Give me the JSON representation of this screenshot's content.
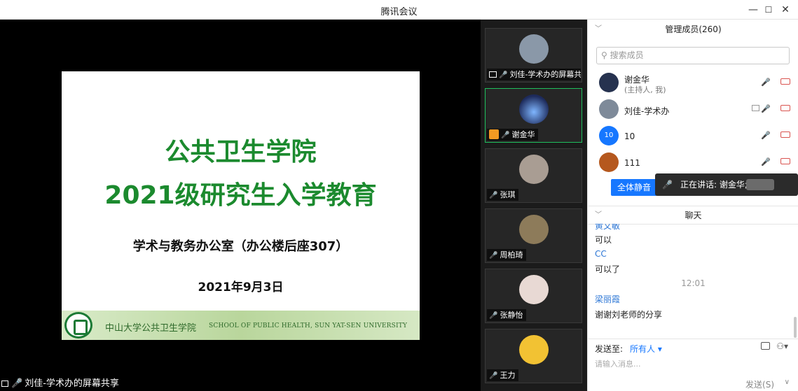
{
  "window": {
    "title": "腾讯会议",
    "minimize": "—",
    "maximize": "☐",
    "close": "✕"
  },
  "slide": {
    "title1": "公共卫生学院",
    "title2": "2021级研究生入学教育",
    "office": "学术与教务办公室（办公楼后座307）",
    "date": "2021年9月3日",
    "footer_cn": "中山大学公共卫生学院",
    "footer_en": "SCHOOL OF PUBLIC HEALTH, SUN YAT-SEN UNIVERSITY"
  },
  "share_label": "刘佳-学术办的屏幕共享",
  "video_tiles": [
    {
      "name": "刘佳-学术办的屏幕共...",
      "icon": "share-screen-icon",
      "mic": "muted"
    },
    {
      "name": "谢金华",
      "icon": "host-icon",
      "mic": "on"
    },
    {
      "name": "张琪",
      "mic": "muted"
    },
    {
      "name": "周柏琦",
      "mic": "muted"
    },
    {
      "name": "张静怡",
      "mic": "muted"
    },
    {
      "name": "王力",
      "mic": "muted"
    }
  ],
  "members_panel": {
    "header": "管理成员(260)",
    "search_placeholder": "搜索成员",
    "members": [
      {
        "name": "谢金华",
        "sub": "(主持人, 我)"
      },
      {
        "name": "刘佳-学术办"
      },
      {
        "name": "10",
        "avatar_text": "10"
      },
      {
        "name": "111"
      }
    ],
    "mute_all": "全体静音"
  },
  "speaking_indicator": "正在讲话: 谢金华;",
  "chat_panel": {
    "header": "聊天",
    "messages": [
      {
        "sender": "黄文敏",
        "text": "可以"
      },
      {
        "sender": "CC",
        "text": "可以了"
      },
      {
        "time": "12:01"
      },
      {
        "sender": "梁丽霞",
        "text": "谢谢刘老师的分享"
      }
    ],
    "send_to_label": "发送至:",
    "send_to_value": "所有人 ▾",
    "input_placeholder": "请输入消息...",
    "send_button": "发送(S)"
  },
  "colors": {
    "accent": "#1677ff",
    "slide_title": "#1b8a2e",
    "active_border": "#1fbf5d",
    "muted": "#d9534f"
  }
}
